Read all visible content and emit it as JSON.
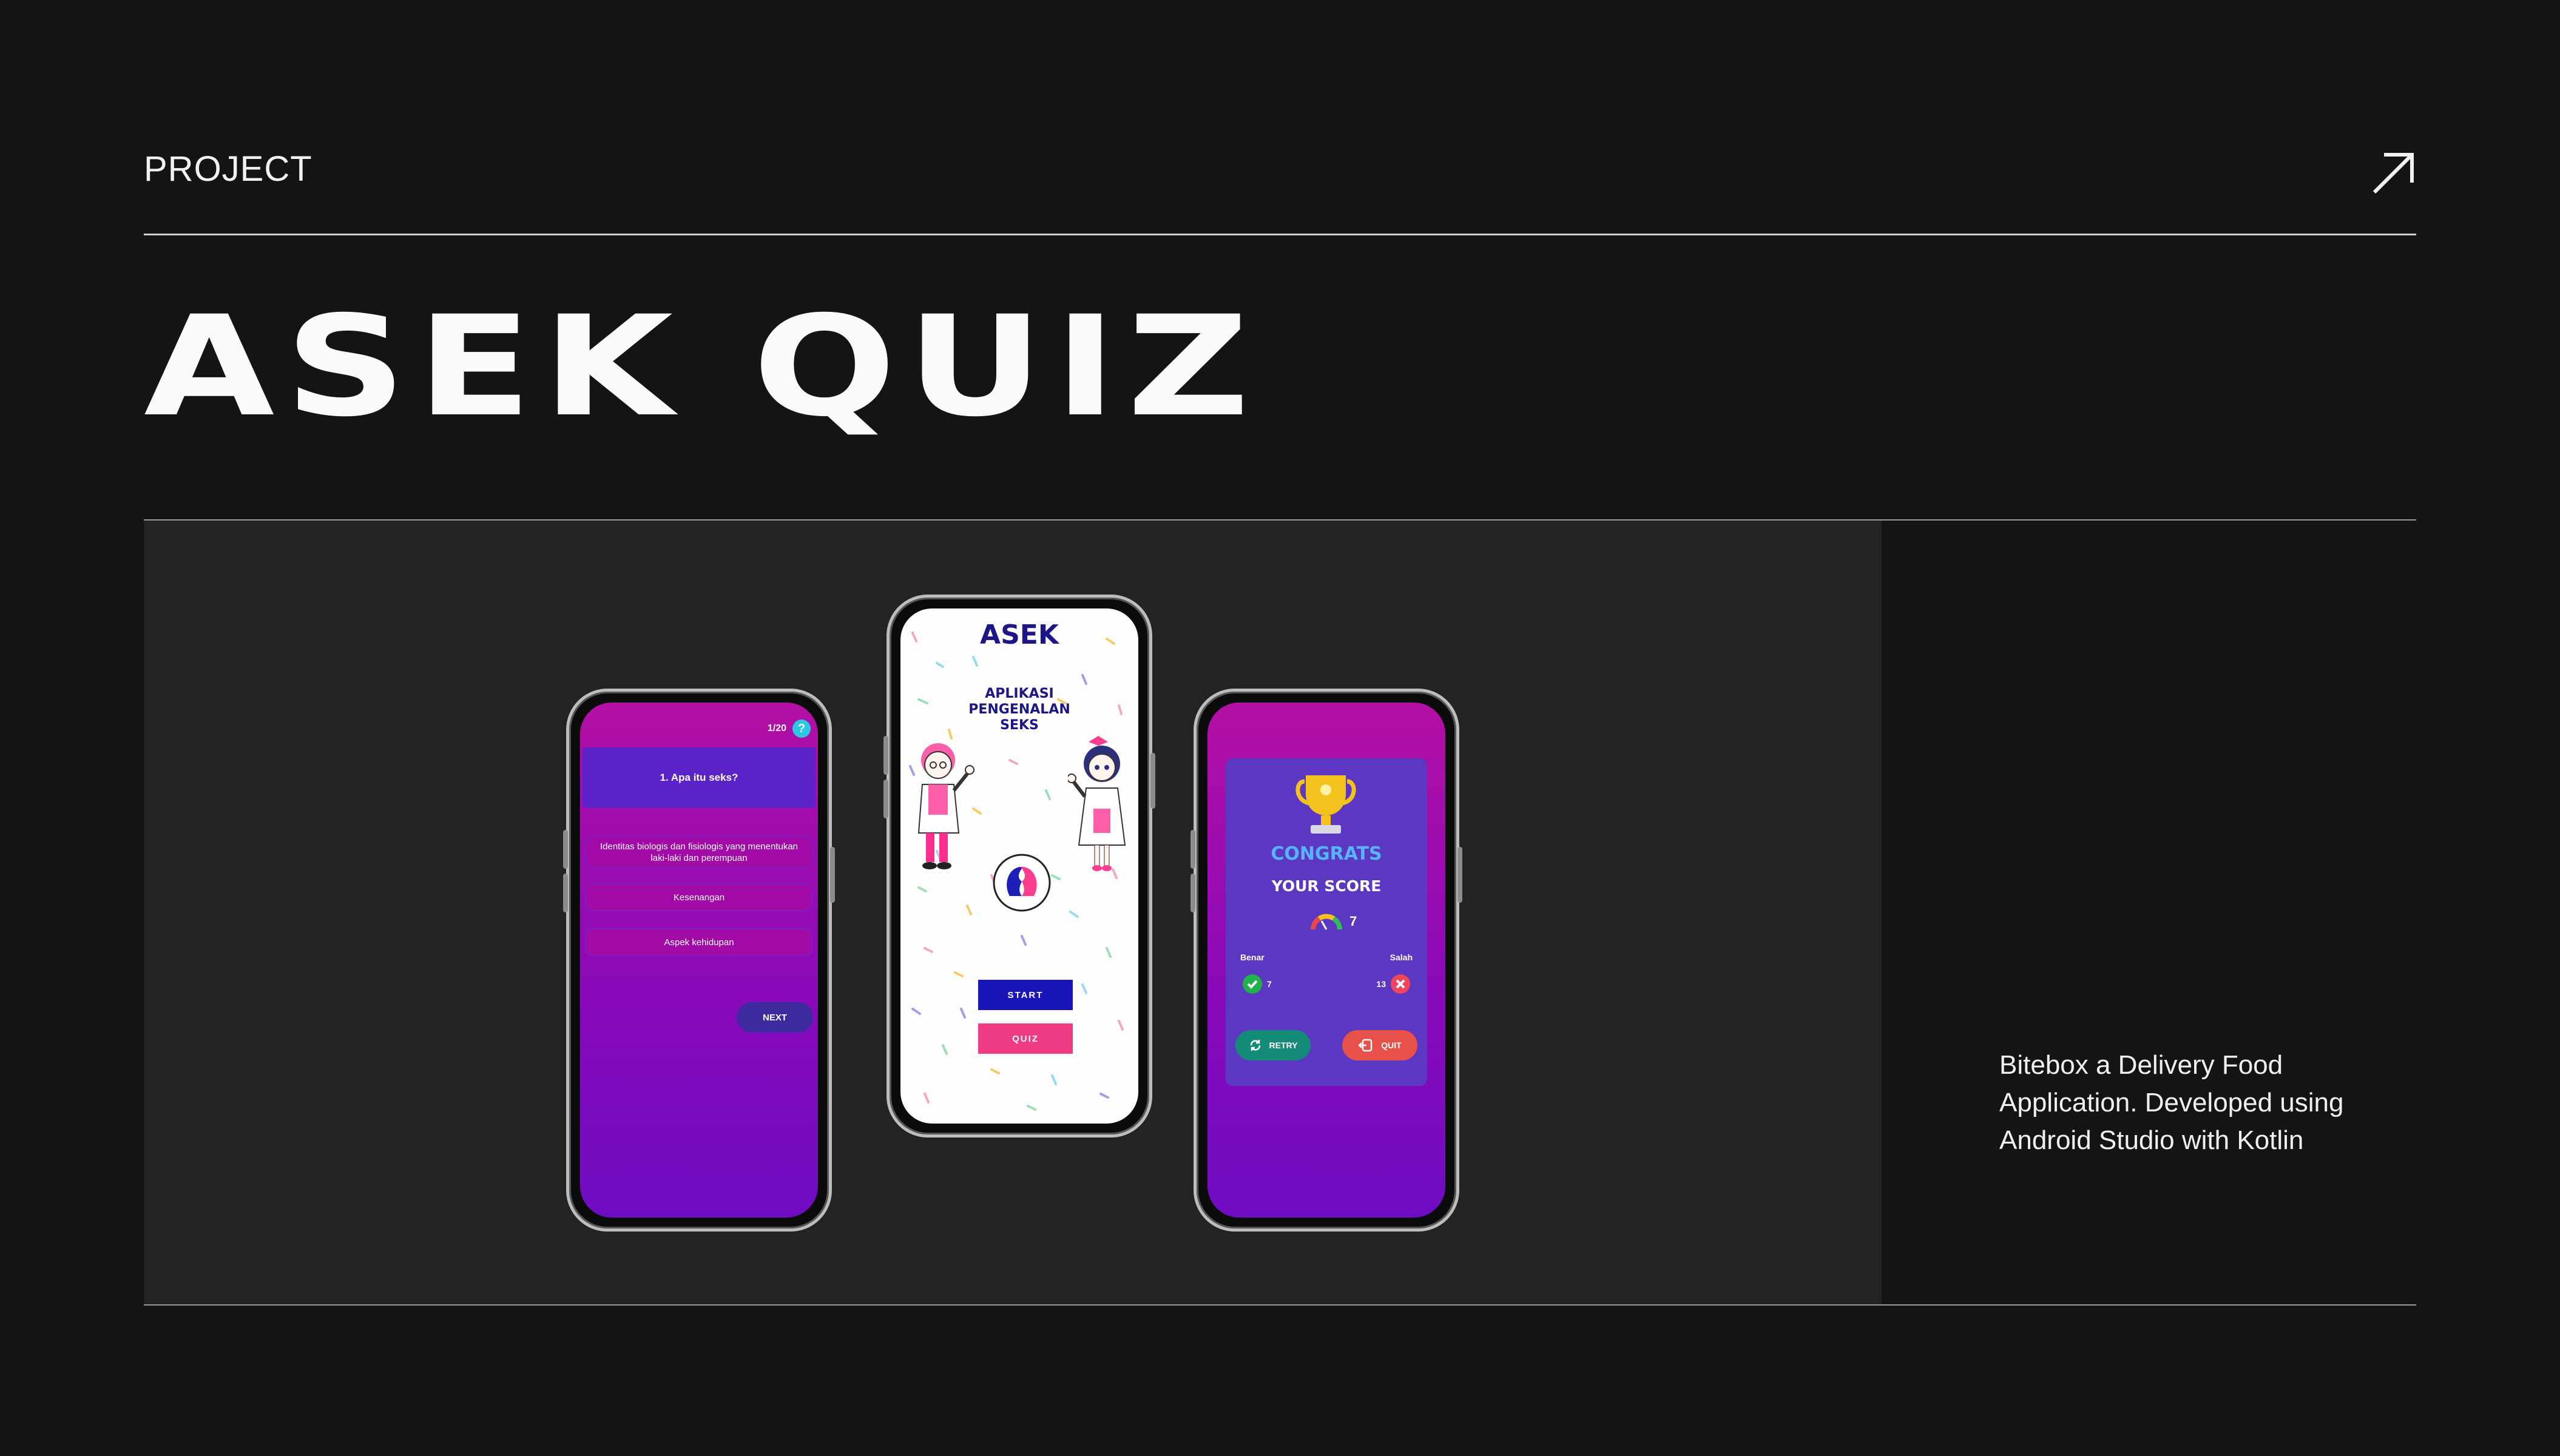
{
  "header": {
    "eyebrow": "PROJECT",
    "arrow_icon": "arrow-up-right-icon"
  },
  "title": "ASEK QUIZ",
  "description": "Bitebox a Delivery Food Application. Developed using Android Studio with Kotlin",
  "colors": {
    "background": "#141414",
    "panel": "#232323",
    "purple": "#8a0ab9",
    "magenta": "#b30fa3",
    "navy": "#1d1688",
    "pink": "#ee3b84"
  },
  "phone_quiz": {
    "counter": "1/20",
    "help_icon": "?",
    "question": "1. Apa itu seks?",
    "options": [
      "Identitas biologis dan fisiologis yang menentukan laki-laki dan perempuan",
      "Kesenangan",
      "Aspek kehidupan"
    ],
    "next_label": "NEXT"
  },
  "phone_home": {
    "app_name": "ASEK",
    "subtitle_lines": [
      "APLIKASI",
      "PENGENALAN",
      "SEKS"
    ],
    "start_label": "START",
    "quiz_label": "QUIZ"
  },
  "phone_result": {
    "congrats": "CONGRATS",
    "your_score": "YOUR SCORE",
    "score": "7",
    "benar_label": "Benar",
    "salah_label": "Salah",
    "benar_count": "7",
    "salah_count": "13",
    "retry_label": "RETRY",
    "quit_label": "QUIT"
  }
}
